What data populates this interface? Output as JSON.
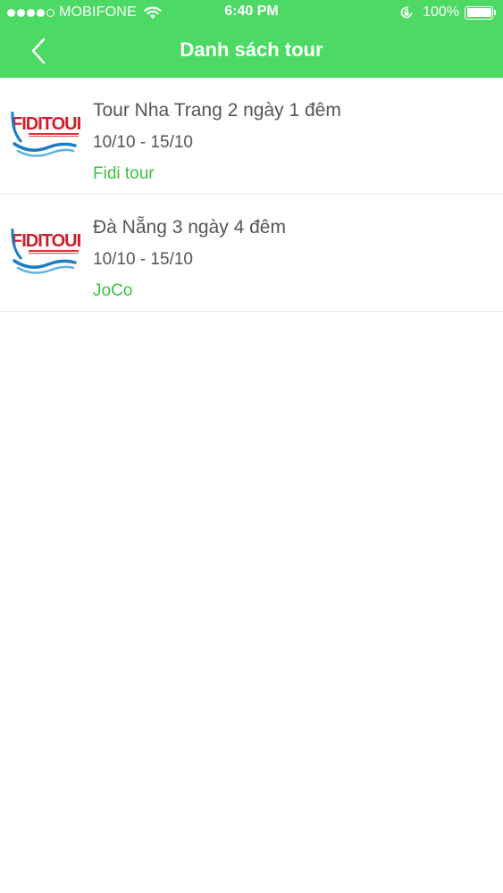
{
  "status_bar": {
    "carrier": "MOBIFONE",
    "time": "6:40 PM",
    "battery": "100%"
  },
  "nav": {
    "title": "Danh sách tour",
    "back_icon": "chevron-left-icon"
  },
  "colors": {
    "header_bg": "#4cd964",
    "agency_text": "#3fbf3f"
  },
  "tours": [
    {
      "name": "Tour Nha Trang 2 ngày 1 đêm",
      "dates": "10/10 - 15/10",
      "agency": "Fidi tour",
      "logo_text": "FIDITOUR"
    },
    {
      "name": "Đà Nẵng 3 ngày 4 đêm",
      "dates": "10/10 - 15/10",
      "agency": "JoCo",
      "logo_text": "FIDITOUR"
    }
  ]
}
